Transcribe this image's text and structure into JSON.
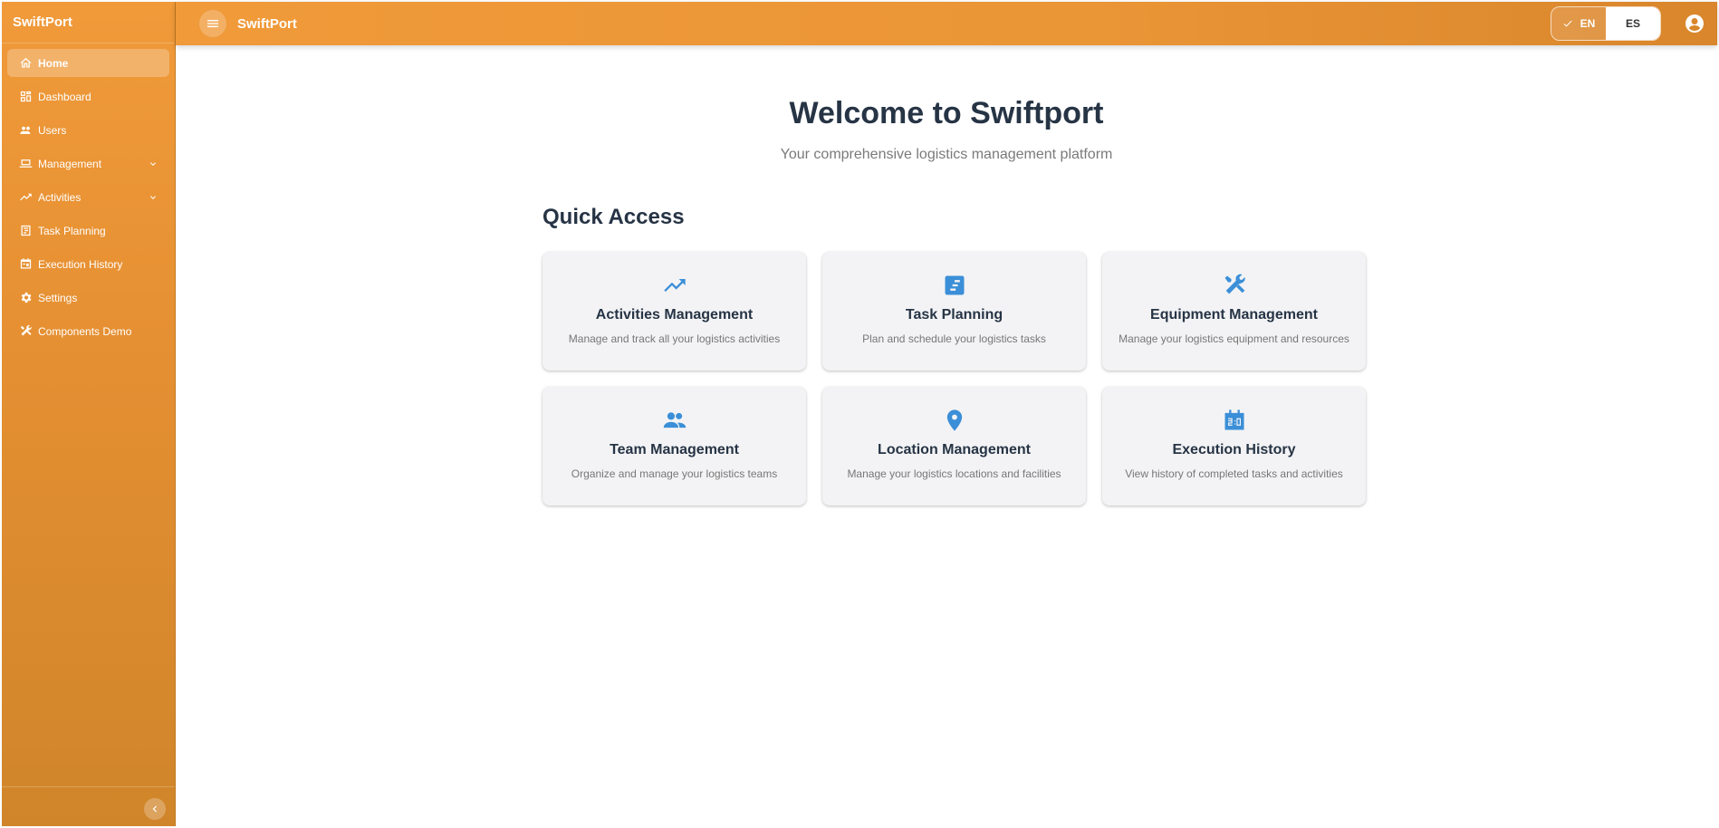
{
  "sidebar": {
    "brand": "SwiftPort",
    "items": [
      {
        "label": "Home",
        "icon": "home-icon"
      },
      {
        "label": "Dashboard",
        "icon": "dashboard-icon"
      },
      {
        "label": "Users",
        "icon": "users-icon"
      },
      {
        "label": "Management",
        "icon": "laptop-icon"
      },
      {
        "label": "Activities",
        "icon": "trending-up-icon"
      },
      {
        "label": "Task Planning",
        "icon": "task-icon"
      },
      {
        "label": "Execution History",
        "icon": "calendar-icon"
      },
      {
        "label": "Settings",
        "icon": "gear-icon"
      },
      {
        "label": "Components Demo",
        "icon": "tools-icon"
      }
    ]
  },
  "header": {
    "title": "SwiftPort",
    "languages": {
      "selected": "EN",
      "other": "ES"
    }
  },
  "main": {
    "welcome": "Welcome to Swiftport",
    "subtitle": "Your comprehensive logistics management platform",
    "quick_access_title": "Quick Access",
    "cards": [
      {
        "title": "Activities Management",
        "description": "Manage and track all your logistics activities",
        "icon": "trending-up-icon"
      },
      {
        "title": "Task Planning",
        "description": "Plan and schedule your logistics tasks",
        "icon": "task-icon"
      },
      {
        "title": "Equipment Management",
        "description": "Manage your logistics equipment and resources",
        "icon": "tools-icon"
      },
      {
        "title": "Team Management",
        "description": "Organize and manage your logistics teams",
        "icon": "team-icon"
      },
      {
        "title": "Location Management",
        "description": "Manage your logistics locations and facilities",
        "icon": "location-pin-icon"
      },
      {
        "title": "Execution History",
        "description": "View history of completed tasks and activities",
        "icon": "calendar-icon"
      }
    ]
  },
  "colors": {
    "accent": "#ee9838",
    "icon_blue": "#3b8fd8",
    "text_dark": "#263445"
  }
}
